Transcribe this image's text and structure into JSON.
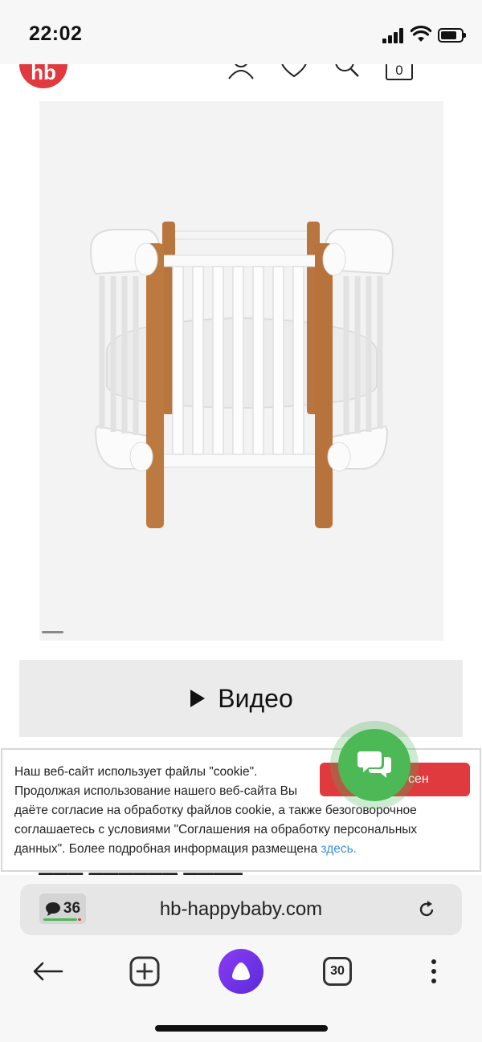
{
  "status_bar": {
    "time": "22:02",
    "battery_level": 0.8
  },
  "header": {
    "logo_text": "hb",
    "cart_count": "0"
  },
  "video": {
    "label": "Видео"
  },
  "cookie": {
    "line1": "Наш веб-сайт использует файлы \"cookie\".",
    "line2": "Продолжая использование нашего веб-сайта Вы",
    "line3": "даёте согласие на обработку файлов cookie, а также безоговорочное",
    "line4": "соглашаетесь с условиями \"Соглашения на обработку персональных",
    "line5": "данных\". Более подробная информация размещена",
    "link": "здесь.",
    "button_visible_text": "сен"
  },
  "browser": {
    "comments_count": "36",
    "url": "hb-happybaby.com",
    "tabs_count": "30"
  },
  "colors": {
    "brand_red": "#e0393e",
    "chat_green": "#4cb856",
    "alice_purple": "#7a35ee",
    "link_blue": "#3d8fd6"
  },
  "icons": [
    "signal-icon",
    "wifi-icon",
    "battery-icon",
    "user-icon",
    "heart-icon",
    "search-icon",
    "cart-icon",
    "menu-icon",
    "play-icon",
    "chat-icon",
    "comment-icon",
    "reload-icon",
    "back-arrow-icon",
    "new-tab-plus-icon",
    "alice-assistant-icon",
    "tabs-icon",
    "more-icon"
  ]
}
